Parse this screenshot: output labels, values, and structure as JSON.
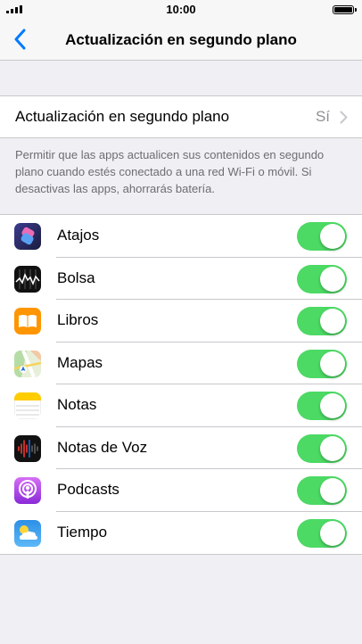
{
  "status_bar": {
    "time": "10:00",
    "signal_bars": 4,
    "battery_icon": "battery-full-icon"
  },
  "nav": {
    "back_icon": "chevron-left-icon",
    "title": "Actualización en segundo plano"
  },
  "main_setting": {
    "label": "Actualización en segundo plano",
    "value": "Sí",
    "chevron_icon": "chevron-right-icon"
  },
  "footer": "Permitir que las apps actualicen sus contenidos en segundo plano cuando estés conectado a una red Wi-Fi o móvil. Si desactivas las apps, ahorrarás batería.",
  "colors": {
    "accent": "#007aff",
    "toggle_on": "#4cd964",
    "background": "#efeff4"
  },
  "apps": [
    {
      "label": "Atajos",
      "icon": "shortcuts-icon",
      "enabled": true
    },
    {
      "label": "Bolsa",
      "icon": "stocks-icon",
      "enabled": true
    },
    {
      "label": "Libros",
      "icon": "books-icon",
      "enabled": true
    },
    {
      "label": "Mapas",
      "icon": "maps-icon",
      "enabled": true
    },
    {
      "label": "Notas",
      "icon": "notes-icon",
      "enabled": true
    },
    {
      "label": "Notas de Voz",
      "icon": "voice-memos-icon",
      "enabled": true
    },
    {
      "label": "Podcasts",
      "icon": "podcasts-icon",
      "enabled": true
    },
    {
      "label": "Tiempo",
      "icon": "weather-icon",
      "enabled": true
    }
  ]
}
